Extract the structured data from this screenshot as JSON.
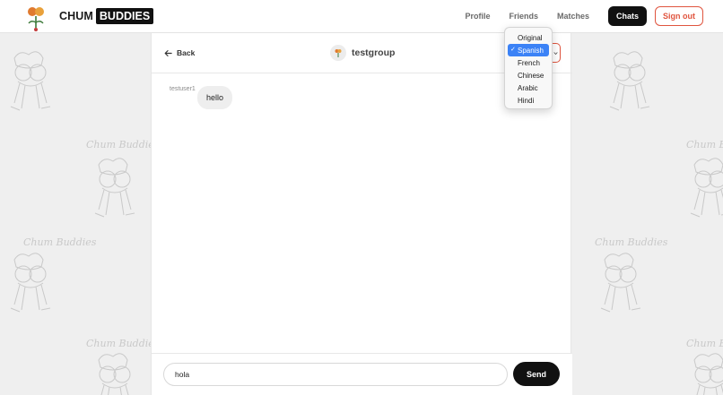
{
  "brand": {
    "part1": "CHUM",
    "part2": "BUDDIES"
  },
  "nav": {
    "profile": "Profile",
    "friends": "Friends",
    "matches": "Matches",
    "chats": "Chats",
    "signout": "Sign out"
  },
  "background": {
    "doodle_text": "Chum Buddies"
  },
  "chat": {
    "back_label": "Back",
    "group_name": "testgroup",
    "messages": [
      {
        "sender": "testuser1",
        "text": "hello"
      }
    ]
  },
  "composer": {
    "value": "hola",
    "send_label": "Send"
  },
  "language_menu": {
    "options": [
      "Original",
      "Spanish",
      "French",
      "Chinese",
      "Arabic",
      "Hindi"
    ],
    "selected": "Spanish",
    "check_glyph": "✓"
  },
  "colors": {
    "accent": "#e0553f",
    "selected": "#3b82f6",
    "dark": "#111111"
  }
}
